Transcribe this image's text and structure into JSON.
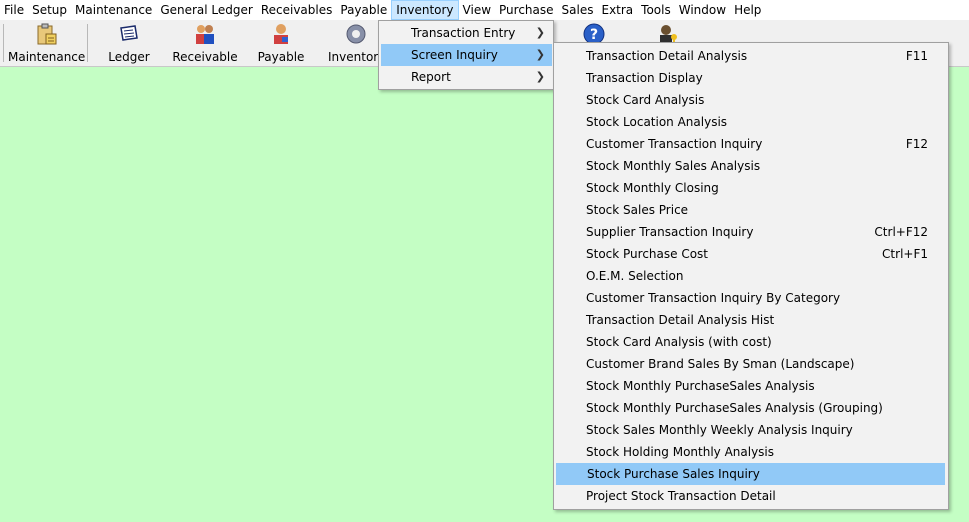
{
  "menubar": {
    "items": [
      "File",
      "Setup",
      "Maintenance",
      "General Ledger",
      "Receivables",
      "Payable",
      "Inventory",
      "View",
      "Purchase",
      "Sales",
      "Extra",
      "Tools",
      "Window",
      "Help"
    ],
    "active_index": 6
  },
  "toolbar": {
    "buttons": [
      {
        "label": "Maintenance",
        "icon": "clipboard-icon"
      },
      {
        "label": "Ledger",
        "icon": "ledger-icon"
      },
      {
        "label": "Receivable",
        "icon": "people-icon"
      },
      {
        "label": "Payable",
        "icon": "person-icon"
      },
      {
        "label": "Inventory",
        "icon": "gear-icon"
      },
      {
        "label": "",
        "icon": "help-icon"
      },
      {
        "label": "",
        "icon": "user-key-icon"
      }
    ]
  },
  "inventory_menu": {
    "items": [
      {
        "label": "Transaction Entry",
        "has_submenu": true
      },
      {
        "label": "Screen Inquiry",
        "has_submenu": true,
        "highlighted": true
      },
      {
        "label": "Report",
        "has_submenu": true
      }
    ]
  },
  "screen_inquiry_menu": {
    "items": [
      {
        "label": "Transaction Detail Analysis",
        "shortcut": "F11"
      },
      {
        "label": "Transaction Display",
        "shortcut": ""
      },
      {
        "label": "Stock Card Analysis",
        "shortcut": ""
      },
      {
        "label": "Stock Location Analysis",
        "shortcut": ""
      },
      {
        "label": "Customer Transaction Inquiry",
        "shortcut": "F12"
      },
      {
        "label": "Stock Monthly Sales Analysis",
        "shortcut": ""
      },
      {
        "label": "Stock Monthly Closing",
        "shortcut": ""
      },
      {
        "label": "Stock Sales Price",
        "shortcut": ""
      },
      {
        "label": "Supplier Transaction Inquiry",
        "shortcut": "Ctrl+F12"
      },
      {
        "label": "Stock Purchase Cost",
        "shortcut": "Ctrl+F1"
      },
      {
        "label": "O.E.M. Selection",
        "shortcut": ""
      },
      {
        "label": "Customer Transaction Inquiry By Category",
        "shortcut": ""
      },
      {
        "label": "Transaction Detail Analysis Hist",
        "shortcut": ""
      },
      {
        "label": "Stock Card Analysis (with cost)",
        "shortcut": ""
      },
      {
        "label": "Customer Brand Sales By Sman (Landscape)",
        "shortcut": ""
      },
      {
        "label": "Stock Monthly PurchaseSales Analysis",
        "shortcut": ""
      },
      {
        "label": "Stock Monthly PurchaseSales Analysis (Grouping)",
        "shortcut": ""
      },
      {
        "label": "Stock Sales Monthly Weekly Analysis Inquiry",
        "shortcut": ""
      },
      {
        "label": "Stock Holding Monthly Analysis",
        "shortcut": ""
      },
      {
        "label": "Stock Purchase Sales Inquiry",
        "shortcut": "",
        "highlighted": true
      },
      {
        "label": "Project Stock Transaction Detail",
        "shortcut": ""
      }
    ]
  },
  "colors": {
    "workspace": "#c4fec4",
    "menu_highlight": "#91c9f7",
    "menubar_active": "#cce8ff"
  }
}
